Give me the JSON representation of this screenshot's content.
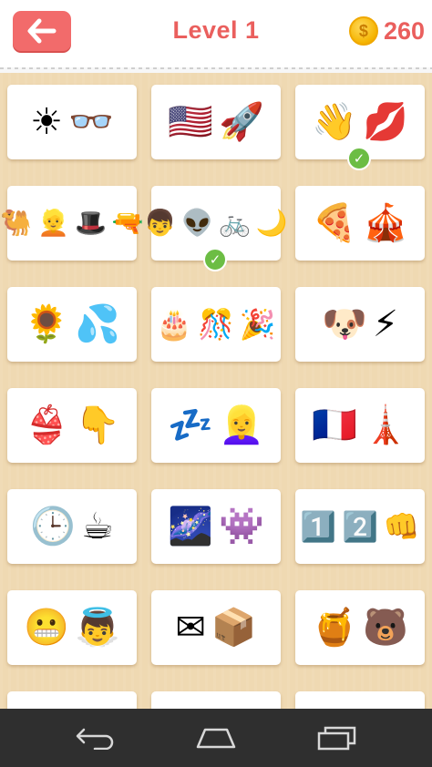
{
  "header": {
    "back_icon": "back-arrow-icon",
    "title": "Level  1",
    "coin_symbol": "$",
    "coins": "260",
    "accent_color": "#f26b6b"
  },
  "puzzles": [
    {
      "emojis": [
        "☀",
        "👓"
      ],
      "solved": false
    },
    {
      "emojis": [
        "🇺🇸",
        "🚀"
      ],
      "solved": false
    },
    {
      "emojis": [
        "👋",
        "💋"
      ],
      "solved": true
    },
    {
      "emojis": [
        "🐫",
        "👱",
        "🎩",
        "🔫"
      ],
      "solved": false
    },
    {
      "emojis": [
        "👦",
        "👽",
        "🚲",
        "🌙"
      ],
      "solved": true
    },
    {
      "emojis": [
        "🍕",
        "🎪"
      ],
      "solved": false
    },
    {
      "emojis": [
        "🌻",
        "💦"
      ],
      "solved": false
    },
    {
      "emojis": [
        "🎂",
        "🎊",
        "🎉"
      ],
      "solved": false
    },
    {
      "emojis": [
        "🐶",
        "⚡"
      ],
      "solved": false
    },
    {
      "emojis": [
        "👙",
        "👇"
      ],
      "solved": false
    },
    {
      "emojis": [
        "💤",
        "👱‍♀"
      ],
      "solved": false
    },
    {
      "emojis": [
        "🇫🇷",
        "🗼"
      ],
      "solved": false
    },
    {
      "emojis": [
        "🕒",
        "☕"
      ],
      "solved": false
    },
    {
      "emojis": [
        "🌌",
        "👾"
      ],
      "solved": false
    },
    {
      "emojis": [
        "1️⃣",
        "2️⃣",
        "👊"
      ],
      "solved": false
    },
    {
      "emojis": [
        "😬",
        "👼"
      ],
      "solved": false
    },
    {
      "emojis": [
        "✉",
        "📦"
      ],
      "solved": false
    },
    {
      "emojis": [
        "🍯",
        "🐻"
      ],
      "solved": false
    }
  ],
  "navbar": {
    "back_icon": "nav-back-icon",
    "home_icon": "nav-home-icon",
    "recents_icon": "nav-recents-icon"
  }
}
